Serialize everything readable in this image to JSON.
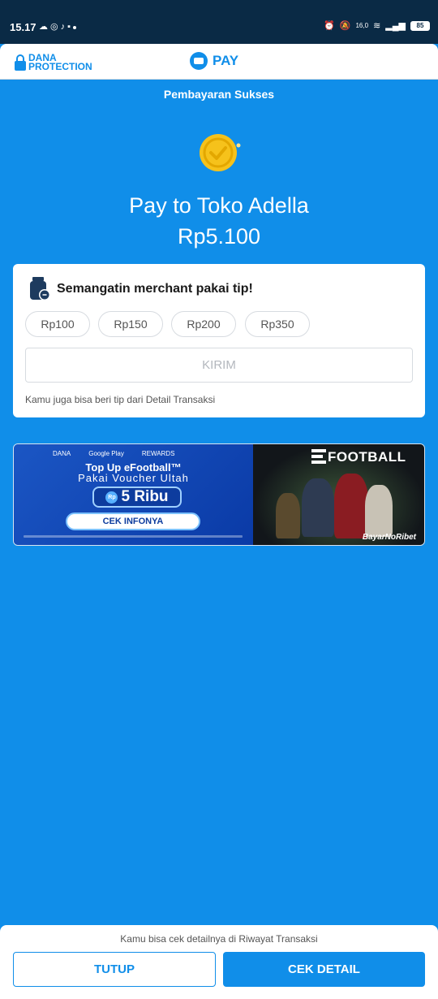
{
  "status_bar": {
    "time": "15.17",
    "left_icons": [
      "cloud-icon",
      "whatsapp-icon",
      "tiktok-icon",
      "wallet-icon"
    ],
    "network_speed": "16,0",
    "battery": "85"
  },
  "header": {
    "protection_logo": "DANA PROTECTION",
    "protection_line1": "DANA",
    "protection_line2": "PROTECTION",
    "pay_label": "PAY"
  },
  "success": {
    "label": "Pembayaran Sukses",
    "pay_to": "Pay to Toko Adella",
    "amount": "Rp5.100"
  },
  "tip": {
    "title": "Semangatin merchant pakai tip!",
    "options": [
      "Rp100",
      "Rp150",
      "Rp200",
      "Rp350"
    ],
    "send_label": "KIRIM",
    "note": "Kamu juga bisa beri tip dari Detail Transaksi"
  },
  "banner": {
    "logos": [
      "DANA",
      "Google Play",
      "REWARDS"
    ],
    "line1": "Top Up eFootball™",
    "line2": "Pakai Voucher Ultah",
    "voucher_rp": "Rp",
    "voucher": "5 Ribu",
    "cta": "CEK INFONYA",
    "brand": "FOOTBALL",
    "tagline": "BayarNoRibet"
  },
  "bottom": {
    "note": "Kamu bisa cek detailnya di Riwayat Transaksi",
    "close_label": "TUTUP",
    "detail_label": "CEK DETAIL"
  },
  "colors": {
    "brand_blue": "#108ee9",
    "status_bar": "#0a2a45",
    "coin_gold": "#f6c21b"
  }
}
